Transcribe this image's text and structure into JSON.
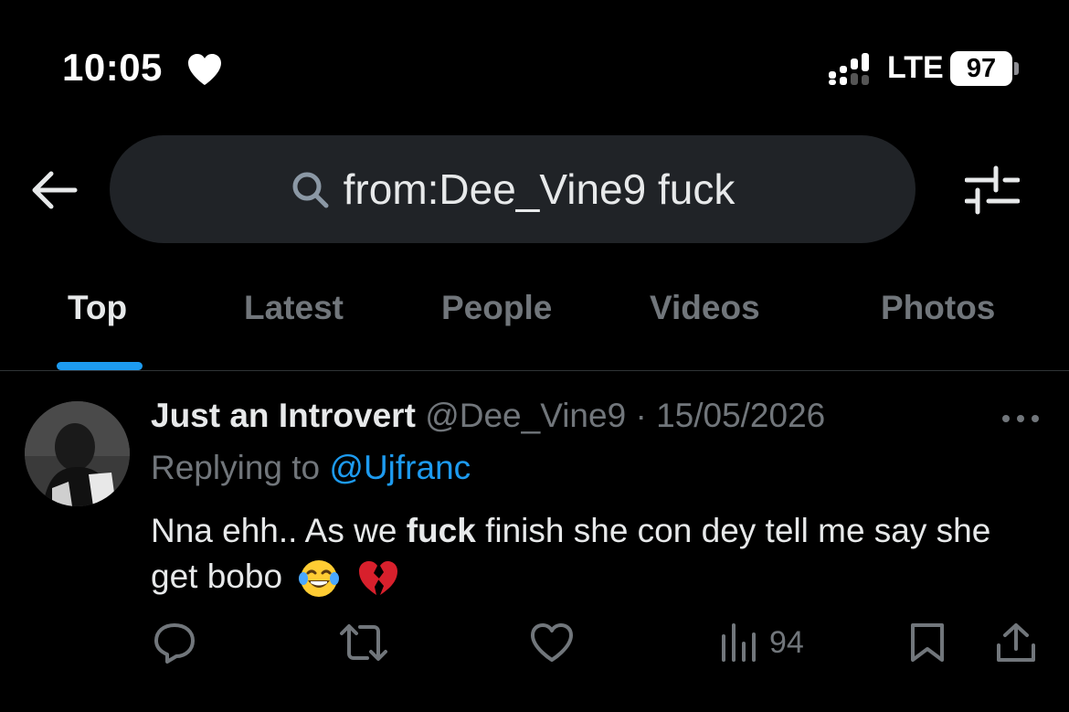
{
  "status_bar": {
    "time": "10:05",
    "network": "LTE",
    "battery": "97"
  },
  "search": {
    "query": "from:Dee_Vine9 fuck"
  },
  "tabs": [
    {
      "label": "Top",
      "active": true
    },
    {
      "label": "Latest",
      "active": false
    },
    {
      "label": "People",
      "active": false
    },
    {
      "label": "Videos",
      "active": false
    },
    {
      "label": "Photos",
      "active": false
    }
  ],
  "tweet": {
    "author_name": "Just an Introvert",
    "handle": "@Dee_Vine9",
    "separator": "·",
    "date": "15/05/2026",
    "replying_to_label": "Replying to",
    "replying_to_handle": "@Ujfranc",
    "body_part1": "Nna ehh.. As we ",
    "body_bold": "fuck",
    "body_part2": " finish she con dey tell me say she get bobo",
    "emojis": [
      "face-with-tears-of-joy",
      "broken-heart"
    ],
    "views": "94"
  },
  "colors": {
    "accent": "#1d9bf0",
    "muted": "#71767b",
    "text": "#e7e9ea",
    "background": "#000000",
    "search_bg": "#202327"
  },
  "icons": [
    "heart-icon",
    "signal-icon",
    "back-arrow-icon",
    "search-icon",
    "filter-icon",
    "more-icon",
    "reply-icon",
    "retweet-icon",
    "like-icon",
    "views-icon",
    "bookmark-icon",
    "share-icon"
  ]
}
